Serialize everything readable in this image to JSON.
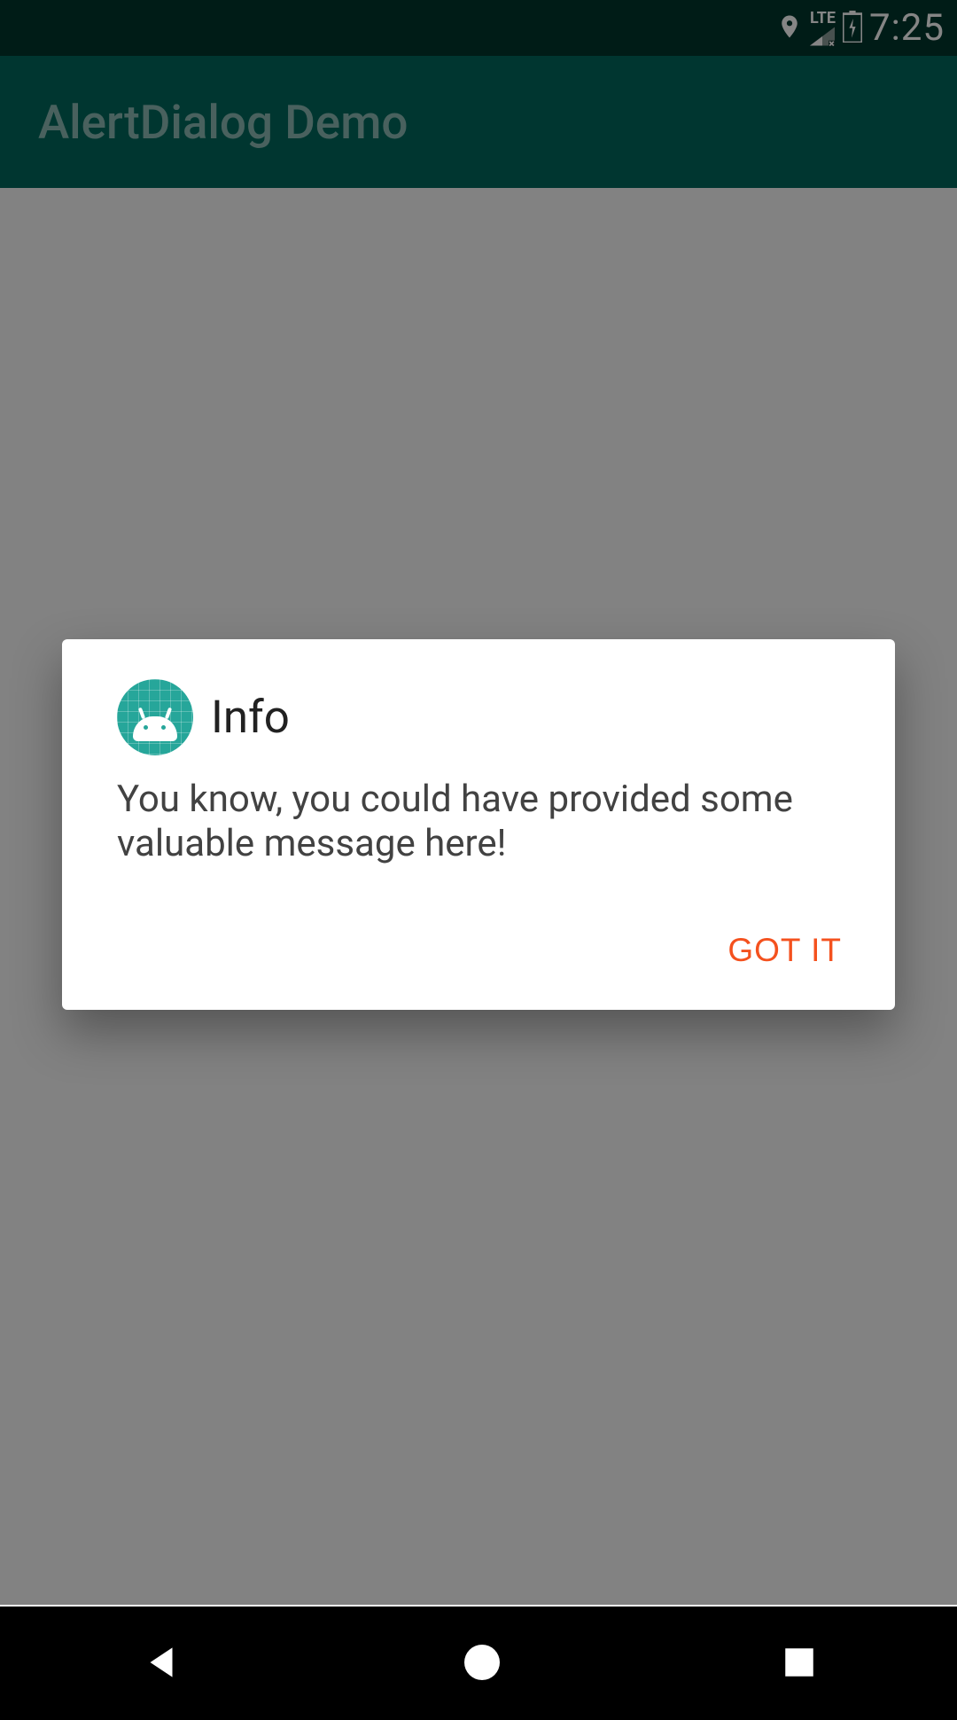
{
  "status_bar": {
    "time": "7:25",
    "lte_label": "LTE",
    "icons": [
      "location",
      "signal-lte-off",
      "battery-charging"
    ]
  },
  "app_bar": {
    "title": "AlertDialog Demo"
  },
  "dialog": {
    "title": "Info",
    "message": "You know, you could have provided some valuable message here!",
    "confirm_label": "GOT IT"
  },
  "nav_bar": {
    "buttons": [
      "back",
      "home",
      "recents"
    ]
  },
  "colors": {
    "primary": "#00695c",
    "primary_dark": "#00362d",
    "accent": "#f4511e",
    "dialog_icon": "#26a69a"
  }
}
